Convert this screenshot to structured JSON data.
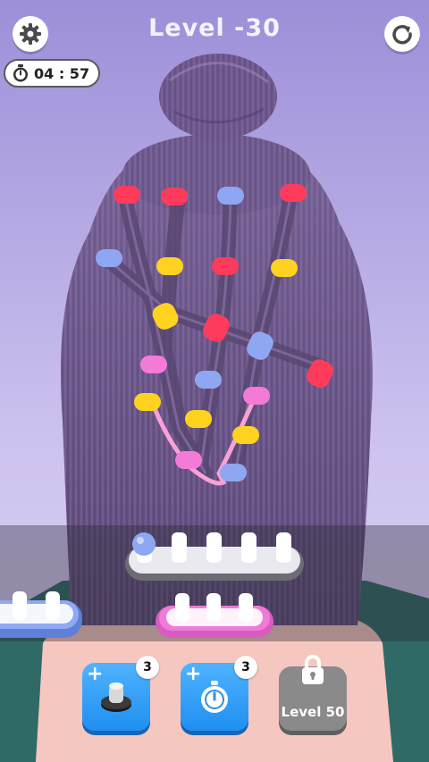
{
  "header": {
    "level_label": "Level -30",
    "settings_icon": "gear-icon",
    "restart_icon": "restart-icon"
  },
  "timer": {
    "icon": "stopwatch-icon",
    "value": "04 : 57"
  },
  "boosters": [
    {
      "icon": "peg-booster-icon",
      "count": "3"
    },
    {
      "icon": "stopwatch-booster-icon",
      "count": "3"
    }
  ],
  "locked_level": {
    "icon": "lock-icon",
    "label": "Level 50"
  },
  "colors": {
    "background_top": "#9d8fd8",
    "hair": "#6b5589",
    "bead_red": "#ff3b5c",
    "bead_yellow": "#ffd21f",
    "bead_blue": "#8fa6f2",
    "bead_pink": "#f47ad8",
    "holder_pink": "#f07ad8",
    "holder_blue": "#7f9ef0",
    "booster_blue": "#2196f3",
    "jacket": "#2f6a66",
    "skin": "#f6c7c0"
  }
}
